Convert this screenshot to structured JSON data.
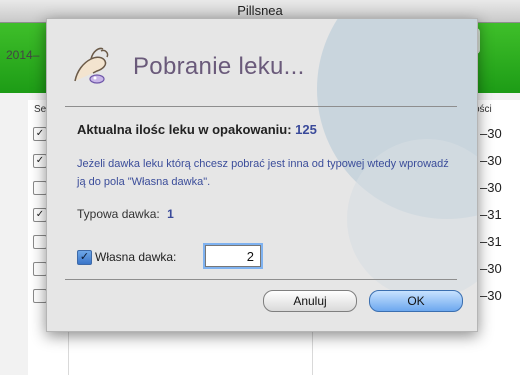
{
  "window": {
    "title": "Pillsnea",
    "toolbar_text": "2014–",
    "table": {
      "header_left": "Se",
      "header_right": "ości",
      "rows": [
        {
          "checked": true,
          "value": "–30"
        },
        {
          "checked": true,
          "value": "–30"
        },
        {
          "checked": false,
          "value": "–30"
        },
        {
          "checked": true,
          "value": "–31"
        },
        {
          "checked": false,
          "value": "–31"
        },
        {
          "checked": false,
          "value": "–30"
        },
        {
          "checked": false,
          "value": "–30"
        }
      ]
    }
  },
  "dialog": {
    "title": "Pobranie leku...",
    "icon": "hand-pill-icon",
    "current_amount_label": "Aktualna ilośc leku w opakowaniu:",
    "current_amount_value": "125",
    "info_text": "Jeżeli dawka leku którą chcesz pobrać jest inna od typowej wtedy wprowadź ją do pola \"Własna dawka\".",
    "typical_dose_label": "Typowa dawka:",
    "typical_dose_value": "1",
    "own_dose_checkbox_checked": true,
    "own_dose_label": "Własna dawka:",
    "own_dose_value": "2",
    "cancel_label": "Anuluj",
    "ok_label": "OK"
  },
  "colors": {
    "toolbar_green": "#1d9c16",
    "title_purple": "#6a5a7a",
    "info_blue": "#3b4d9a",
    "ok_button_blue": "#6da8ef"
  }
}
